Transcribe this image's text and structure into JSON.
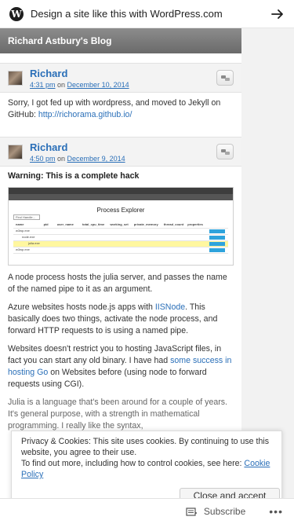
{
  "wpbar": {
    "text": "Design a site like this with WordPress.com",
    "logo_glyph": "W"
  },
  "blog": {
    "title": "Richard Astbury's Blog"
  },
  "comments": [
    {
      "author": "Richard",
      "time": "4:31 pm",
      "date_prefix": " on ",
      "date": "December 10, 2014",
      "text_before_link": "Sorry, I got fed up with wordpress, and moved to Jekyll on GitHub: ",
      "link": "http://richorama.github.io/"
    },
    {
      "author": "Richard",
      "time": "4:50 pm",
      "date_prefix": " on ",
      "date": "December 9, 2014"
    }
  ],
  "post": {
    "warning": "Warning: This is a complete hack",
    "figure": {
      "title": "Process Explorer",
      "find_label": "Find Handle...",
      "headers": [
        "name",
        "pid",
        "user_name",
        "total_cpu_time",
        "working_set",
        "private_memory",
        "thread_count",
        "properties"
      ],
      "rows": [
        "w3wp.exe",
        "node.exe",
        "julia.exe",
        "w3wp.exe"
      ]
    },
    "p1": "A node process hosts the julia server, and passes the name of the named pipe to it as an argument.",
    "p2_before": "Azure websites hosts node.js apps with ",
    "p2_link": "IISNode",
    "p2_after": ". This basically does two things, activate the node process, and forward HTTP requests to is using a named pipe.",
    "p3_before": "Websites doesn't restrict you to hosting JavaScript files, in fact you can start any old binary. I have had ",
    "p3_link": "some success in hosting Go",
    "p3_after": " on Websites before (using node to forward requests using CGI).",
    "p4": "Julia is a language that's been around for a couple of years. It's general purpose, with a strength in mathematical programming. I really like the syntax,"
  },
  "cookie": {
    "text1": "Privacy & Cookies: This site uses cookies. By continuing to use this website, you agree to their use.",
    "text2": "To find out more, including how to control cookies, see here: ",
    "link": "Cookie Policy",
    "button": "Close and accept"
  },
  "bottombar": {
    "subscribe": "Subscribe",
    "more": "•••"
  },
  "colors": {
    "link": "#2a6fb8",
    "header_bg": "#7a7a7a"
  }
}
